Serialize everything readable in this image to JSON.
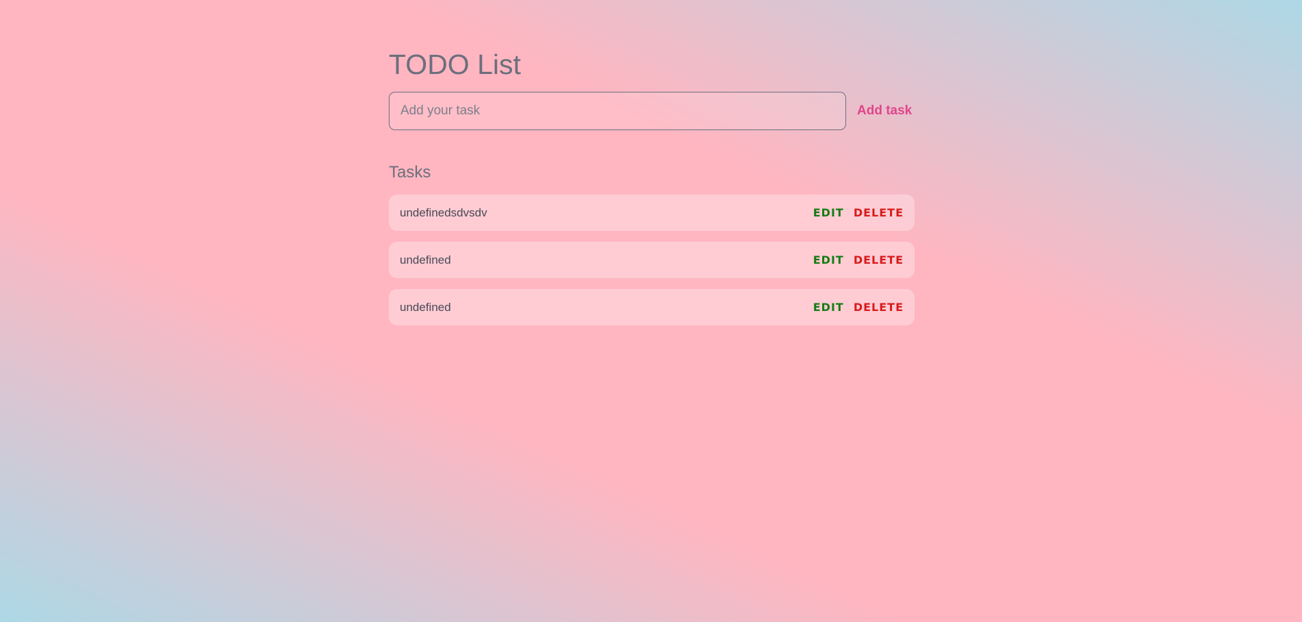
{
  "app": {
    "title": "TODO List"
  },
  "form": {
    "input_placeholder": "Add your task",
    "input_value": "",
    "add_button_label": "Add task"
  },
  "tasks_section": {
    "title": "Tasks",
    "items": [
      {
        "text": "undefinedsdvsdv",
        "edit_label": "EDIT",
        "delete_label": "DELETE"
      },
      {
        "text": "undefined",
        "edit_label": "EDIT",
        "delete_label": "DELETE"
      },
      {
        "text": "undefined",
        "edit_label": "EDIT",
        "delete_label": "DELETE"
      }
    ]
  },
  "colors": {
    "title_text": "#6b6f7d",
    "accent_add": "#e0458a",
    "edit": "#157c15",
    "delete": "#d81b1b",
    "gradient_pink": "#ffb6c1",
    "gradient_blue": "#add8e6"
  }
}
